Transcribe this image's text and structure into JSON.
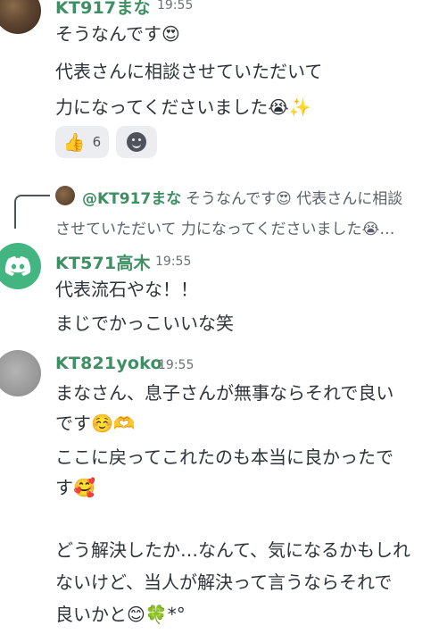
{
  "messages": [
    {
      "author": "KT917まな",
      "time": "19:55",
      "lines": [
        "そうなんです😍",
        "代表さんに相談させていただいて",
        "力になってくださいました😭✨"
      ],
      "reactions": [
        {
          "emoji": "👍",
          "count": "6"
        },
        {
          "icon": "add-reaction-icon"
        }
      ]
    },
    {
      "reply": {
        "mention": "@KT917まな",
        "text_line1": "そうなんです😍 代表さんに相談",
        "text_line2": "させていただいて 力になってくださいました😭…"
      },
      "author": "KT571高木",
      "time": "19:55",
      "lines": [
        "代表流石やな！！",
        "まじでかっこいいな笑"
      ]
    },
    {
      "author": "KT821yoko",
      "time": "19:55",
      "lines": [
        "まなさん、息子さんが無事ならそれで良い",
        "です☺️🫶",
        "ここに戻ってこれたのも本当に良かったで",
        "す🥰",
        "どう解決したか…なんて、気になるかもしれ",
        "ないけど、当人が解決って言うならそれで",
        "良いかと😊🍀*°"
      ]
    }
  ],
  "colors": {
    "username": "#3e8f63",
    "discord_blurple": "#43b581",
    "reaction_bg": "#ebedf0",
    "text": "#2e3338"
  }
}
